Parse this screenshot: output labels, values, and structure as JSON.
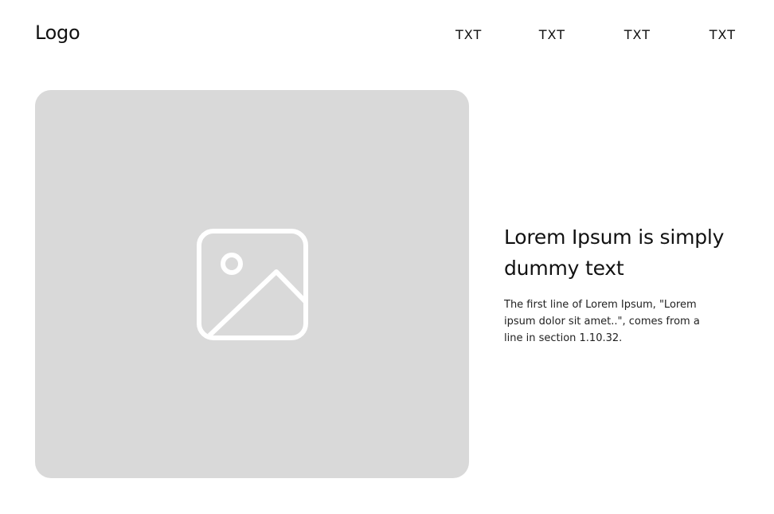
{
  "header": {
    "logo": "Logo",
    "nav": [
      "TXT",
      "TXT",
      "TXT",
      "TXT"
    ]
  },
  "hero": {
    "image_icon": "image-placeholder-icon",
    "image_bg_color": "#d9d9d9",
    "title": "Lorem Ipsum is simply dummy text",
    "body": "The first line of Lorem Ipsum, \"Lorem ipsum dolor sit amet..\", comes from a line in section 1.10.32."
  }
}
